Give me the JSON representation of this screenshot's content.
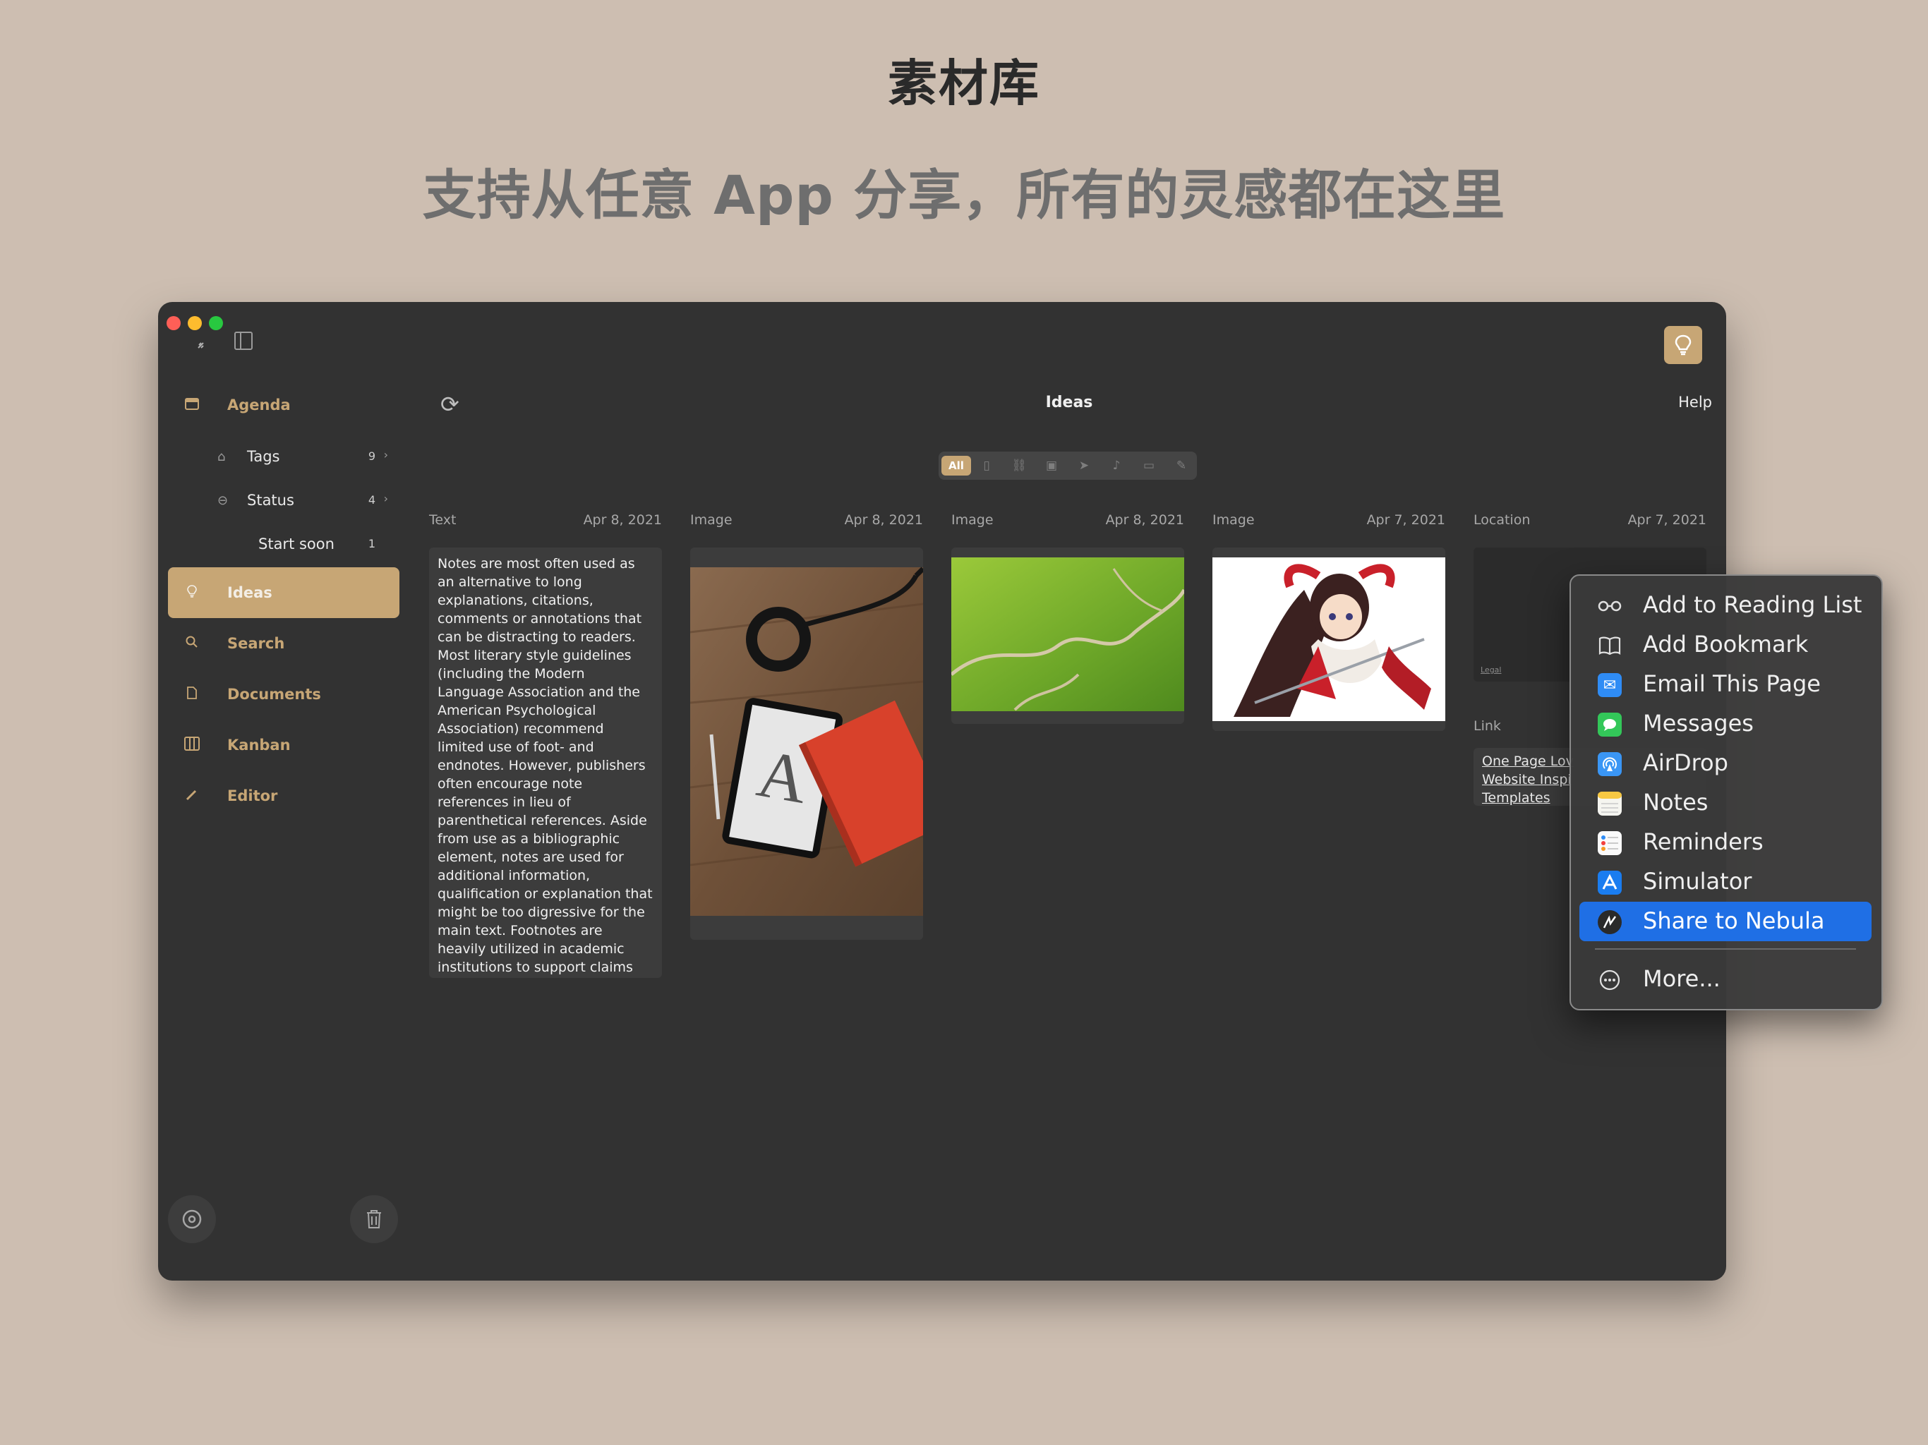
{
  "hero": {
    "title": "素材库",
    "subtitle": "支持从任意 App 分享，所有的灵感都在这里"
  },
  "window": {
    "toolbar": {
      "back_icon": "arrow-icon",
      "sidebar_icon": "sidebar-icon",
      "bulb_icon": "lightbulb-icon"
    },
    "sidebar": {
      "agenda": "Agenda",
      "tags": {
        "label": "Tags",
        "count": "9"
      },
      "status": {
        "label": "Status",
        "count": "4"
      },
      "start_soon": {
        "label": "Start soon",
        "count": "1"
      },
      "ideas": "Ideas",
      "search": "Search",
      "documents": "Documents",
      "kanban": "Kanban",
      "editor": "Editor"
    },
    "main": {
      "title": "Ideas",
      "help": "Help",
      "filter_all": "All",
      "columns": [
        {
          "type": "Text",
          "date": "Apr 8, 2021"
        },
        {
          "type": "Image",
          "date": "Apr 8, 2021"
        },
        {
          "type": "Image",
          "date": "Apr 8, 2021"
        },
        {
          "type": "Image",
          "date": "Apr 7, 2021"
        },
        {
          "type": "Location",
          "date": "Apr 7, 2021"
        }
      ],
      "text_card": "Notes are most often used as an alternative to long explanations, citations, comments or annotations that can be distracting to readers. Most literary style guidelines (including the Modern Language Association and the American Psychological Association) recommend limited use of foot- and endnotes. However, publishers often encourage note references in lieu of parenthetical references. Aside from use as a bibliographic element, notes are used for additional information, qualification or explanation that might be too digressive for the main text. Footnotes are heavily utilized in academic institutions to support claims made in academic essays covering myriad topics.",
      "map_legal": "Legal",
      "link_label": "Link",
      "link_text": "One Page Lov Website Inspi Templates"
    },
    "share_menu": {
      "items": [
        {
          "label": "Add to Reading List",
          "icon": "glasses-icon"
        },
        {
          "label": "Add Bookmark",
          "icon": "book-icon"
        },
        {
          "label": "Email This Page",
          "icon": "mail-icon"
        },
        {
          "label": "Messages",
          "icon": "messages-icon"
        },
        {
          "label": "AirDrop",
          "icon": "airdrop-icon"
        },
        {
          "label": "Notes",
          "icon": "notes-icon"
        },
        {
          "label": "Reminders",
          "icon": "reminders-icon"
        },
        {
          "label": "Simulator",
          "icon": "simulator-icon"
        },
        {
          "label": "Share to Nebula",
          "icon": "nebula-icon"
        },
        {
          "label": "More...",
          "icon": "more-icon"
        }
      ],
      "selected": "Share to Nebula"
    },
    "colors": {
      "accent": "#c7a675",
      "selection": "#1f6fe5",
      "window_bg": "#323232"
    }
  }
}
